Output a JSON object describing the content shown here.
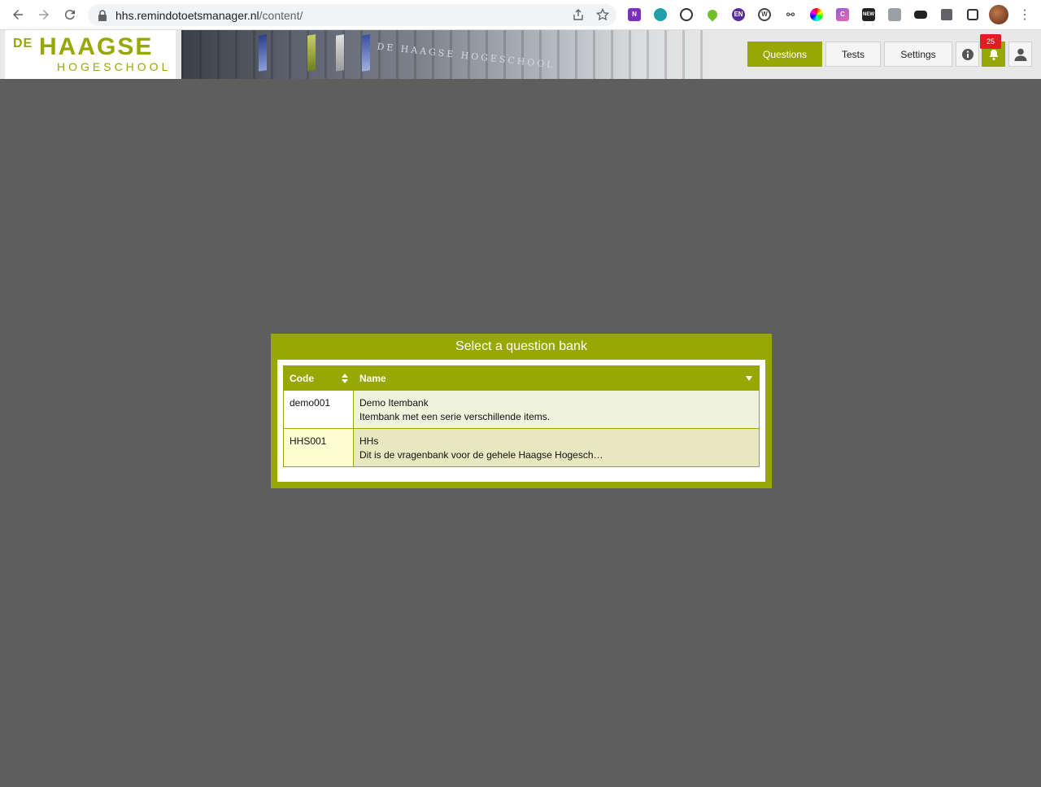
{
  "browser": {
    "url_host": "hhs.remindotoetsmanager.nl",
    "url_path": "/content/"
  },
  "header": {
    "logo_de": "DE",
    "logo_haagse": "HAAGSE",
    "logo_hogeschool": "HOGESCHOOL",
    "banner_sign": "DE HAAGSE HOGESCHOOL",
    "nav": {
      "questions": "Questions",
      "tests": "Tests",
      "settings": "Settings"
    },
    "notification_count": "25"
  },
  "dialog": {
    "title": "Select a question bank",
    "columns": {
      "code": "Code",
      "name": "Name"
    },
    "rows": [
      {
        "code": "demo001",
        "name": "Demo Itembank",
        "description": "Itembank met een serie verschillende items."
      },
      {
        "code": "HHS001",
        "name": "HHs",
        "description": "Dit is de vragenbank voor de gehele Haagse Hogesch…"
      }
    ]
  },
  "colors": {
    "brand_green": "#97a806",
    "background": "#5e5e5e",
    "badge_red": "#e31b23"
  }
}
